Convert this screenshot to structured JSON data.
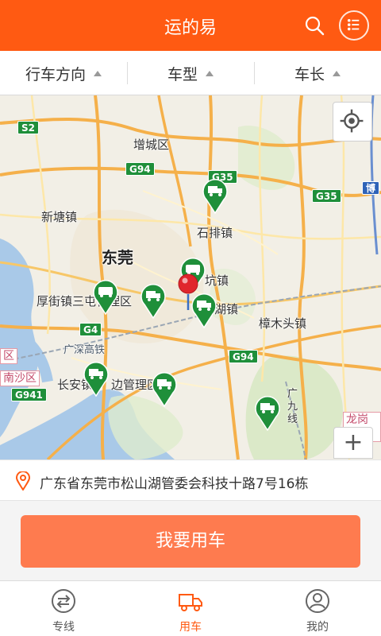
{
  "header": {
    "title": "运的易",
    "search_icon": "search-icon",
    "menu_icon": "list-menu-icon"
  },
  "filters": [
    {
      "label": "行车方向"
    },
    {
      "label": "车型"
    },
    {
      "label": "车长"
    }
  ],
  "map": {
    "road_badges": [
      "S2",
      "G94",
      "G35",
      "G35",
      "G4",
      "G94",
      "G941"
    ],
    "places": [
      "增城区",
      "新塘镇",
      "石排镇",
      "东莞",
      "厚街镇三屯管理区",
      "坑镇",
      "湖镇",
      "樟木头镇",
      "广深高铁",
      "区",
      "南沙区",
      "长安镇",
      "边管理区",
      "广九线",
      "龙岗区",
      "博"
    ],
    "truck_pin_count": 8,
    "locate_icon": "crosshair-locate-icon",
    "zoom_in_label": "+"
  },
  "address": {
    "icon": "location-pin-icon",
    "text": "广东省东莞市松山湖管委会科技十路7号16栋"
  },
  "cta": {
    "label": "我要用车"
  },
  "tabs": [
    {
      "label": "专线",
      "icon": "route-exchange-icon",
      "active": false
    },
    {
      "label": "用车",
      "icon": "truck-icon",
      "active": true
    },
    {
      "label": "我的",
      "icon": "user-profile-icon",
      "active": false
    }
  ],
  "colors": {
    "brand": "#ff5a12",
    "cta": "#fe7b4f",
    "pin_green": "#1f8f3a",
    "pin_red": "#e0262d"
  }
}
